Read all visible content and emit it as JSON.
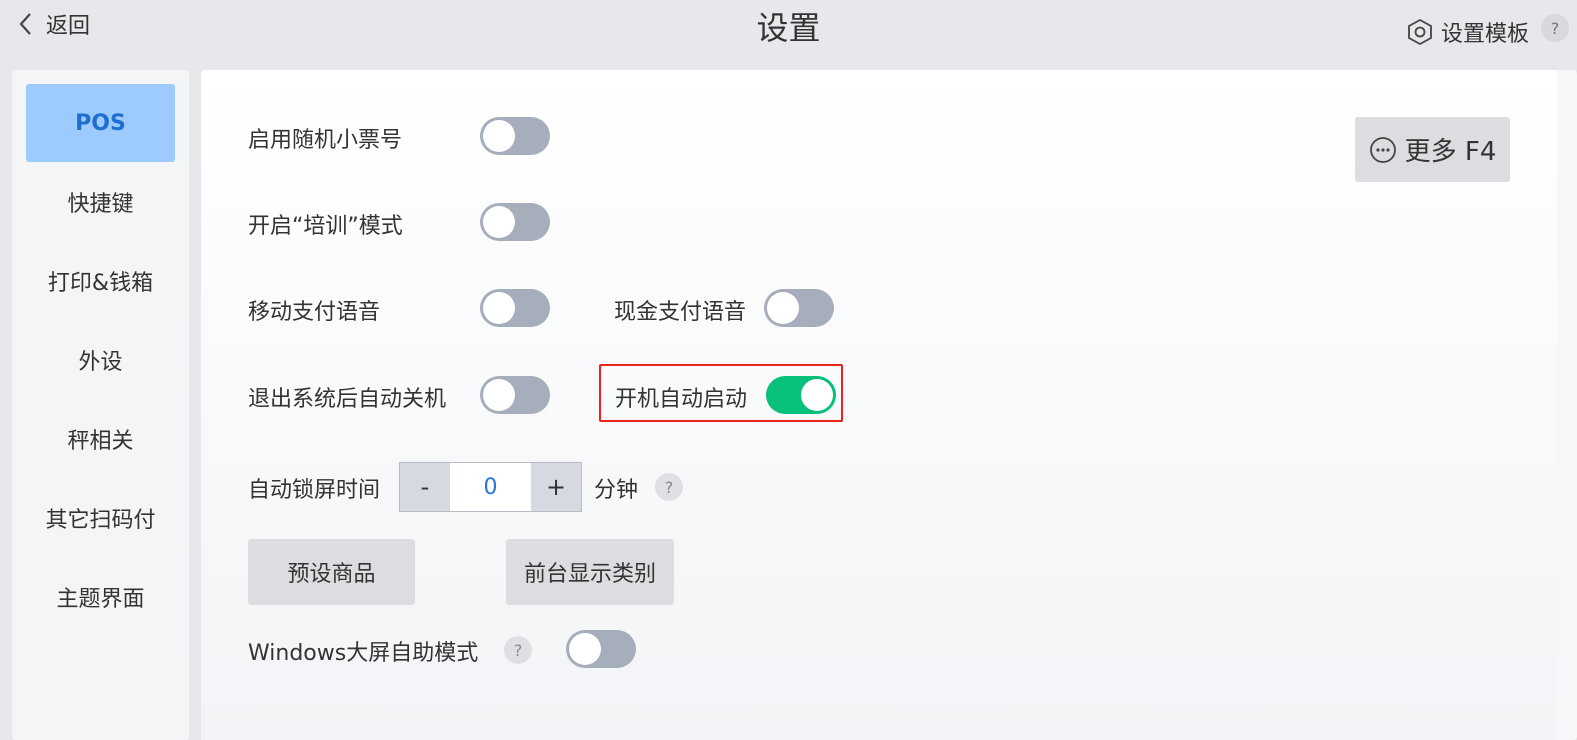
{
  "header": {
    "back_label": "返回",
    "title": "设置",
    "template_label": "设置模板",
    "help": "?"
  },
  "sidebar": {
    "items": [
      {
        "label": "POS",
        "active": true
      },
      {
        "label": "快捷键"
      },
      {
        "label": "打印&钱箱"
      },
      {
        "label": "外设"
      },
      {
        "label": "秤相关"
      },
      {
        "label": "其它扫码付"
      },
      {
        "label": "主题界面"
      }
    ]
  },
  "settings": {
    "random_receipt": {
      "label": "启用随机小票号",
      "enabled": false
    },
    "training_mode": {
      "label": "开启“培训”模式",
      "enabled": false
    },
    "mobile_pay_voice": {
      "label": "移动支付语音",
      "enabled": false
    },
    "cash_pay_voice": {
      "label": "现金支付语音",
      "enabled": false
    },
    "auto_shutdown": {
      "label": "退出系统后自动关机",
      "enabled": false
    },
    "auto_start": {
      "label": "开机自动启动",
      "enabled": true
    },
    "lock_time": {
      "label": "自动锁屏时间",
      "minus": "-",
      "value": "0",
      "plus": "+",
      "unit": "分钟",
      "help": "?"
    },
    "preset_goods_button": "预设商品",
    "front_category_button": "前台显示类别",
    "windows_kiosk": {
      "label": "Windows大屏自助模式",
      "help": "?",
      "enabled": false
    }
  },
  "more_button": {
    "label": "更多 F4"
  },
  "colors": {
    "accent": "#07c07a",
    "active_tab_bg": "#9ecbfd",
    "active_tab_text": "#1f6fd1",
    "highlight": "#e8241c",
    "toggle_off": "#a6adbb"
  }
}
